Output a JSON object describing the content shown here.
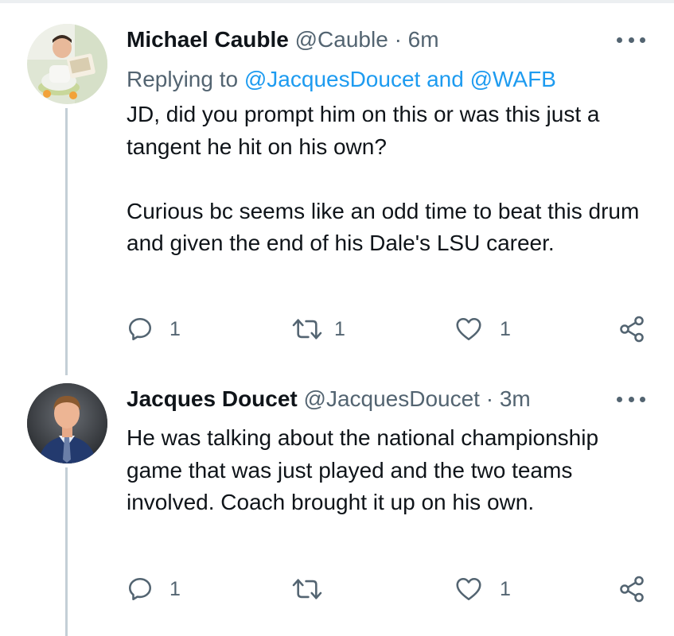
{
  "tweets": [
    {
      "name": "Michael Cauble",
      "handle": "@Cauble",
      "separator": "·",
      "time": "6m",
      "replying_prefix": "Replying to",
      "mentions": [
        "@JacquesDoucet",
        "@WAFB"
      ],
      "mention_joiner": "and",
      "body": [
        "JD, did you prompt him on this or was this just a tangent he hit on his own?",
        "Curious bc seems like an odd time to beat this drum and given the end of his Dale's LSU career."
      ],
      "reply_count": "1",
      "retweet_count": "1",
      "like_count": "1"
    },
    {
      "name": "Jacques Doucet",
      "handle": "@JacquesDoucet",
      "separator": "·",
      "time": "3m",
      "body": [
        "He was talking about the national championship game that was just played and the two teams involved. Coach brought it up on his own."
      ],
      "reply_count": "1",
      "retweet_count": "",
      "like_count": "1"
    }
  ],
  "icons": {
    "reply": "reply-icon",
    "retweet": "retweet-icon",
    "like": "heart-icon",
    "share": "share-icon",
    "more": "more-options-icon"
  },
  "colors": {
    "mention": "#1d9bf0",
    "secondary_text": "#536471",
    "thread_line": "#c4cfd6"
  }
}
